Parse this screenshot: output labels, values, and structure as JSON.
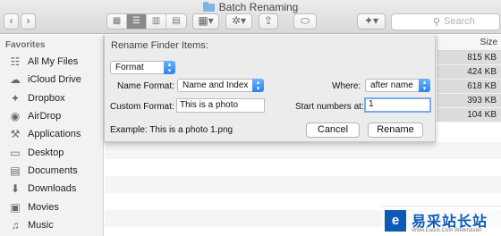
{
  "window": {
    "title": "Batch Renaming"
  },
  "toolbar": {
    "back_glyph": "‹",
    "forward_glyph": "›",
    "view_modes": [
      "▦",
      "☰",
      "▥",
      "▤"
    ],
    "arrange_glyph": "▦▾",
    "action_glyph": "✲▾",
    "share_glyph": "⇪",
    "tag_glyph": "⬭",
    "dropbox_glyph": "✦▾",
    "search_placeholder": "Search"
  },
  "sidebar": {
    "heading": "Favorites",
    "items": [
      {
        "label": "All My Files",
        "icon": "☷"
      },
      {
        "label": "iCloud Drive",
        "icon": "☁"
      },
      {
        "label": "Dropbox",
        "icon": "✦"
      },
      {
        "label": "AirDrop",
        "icon": "◉"
      },
      {
        "label": "Applications",
        "icon": "⚒"
      },
      {
        "label": "Desktop",
        "icon": "▭"
      },
      {
        "label": "Documents",
        "icon": "▤"
      },
      {
        "label": "Downloads",
        "icon": "⬇"
      },
      {
        "label": "Movies",
        "icon": "▣"
      },
      {
        "label": "Music",
        "icon": "♫"
      }
    ]
  },
  "filelist": {
    "size_header": "Size",
    "sizes": [
      "815 KB",
      "424 KB",
      "618 KB",
      "393 KB",
      "104 KB"
    ]
  },
  "rename_sheet": {
    "title": "Rename Finder Items:",
    "mode": "Format",
    "name_format_label": "Name Format:",
    "name_format_value": "Name and Index",
    "where_label": "Where:",
    "where_value": "after name",
    "custom_format_label": "Custom Format:",
    "custom_format_value": "This is a photo",
    "start_numbers_label": "Start numbers at:",
    "start_numbers_value": "1",
    "example": "Example: This is a photo 1.png",
    "cancel_label": "Cancel",
    "rename_label": "Rename"
  },
  "watermark": {
    "logo_char": "e",
    "brand": "易采站长站",
    "url": "Www.Easck.Com Webmaster"
  }
}
